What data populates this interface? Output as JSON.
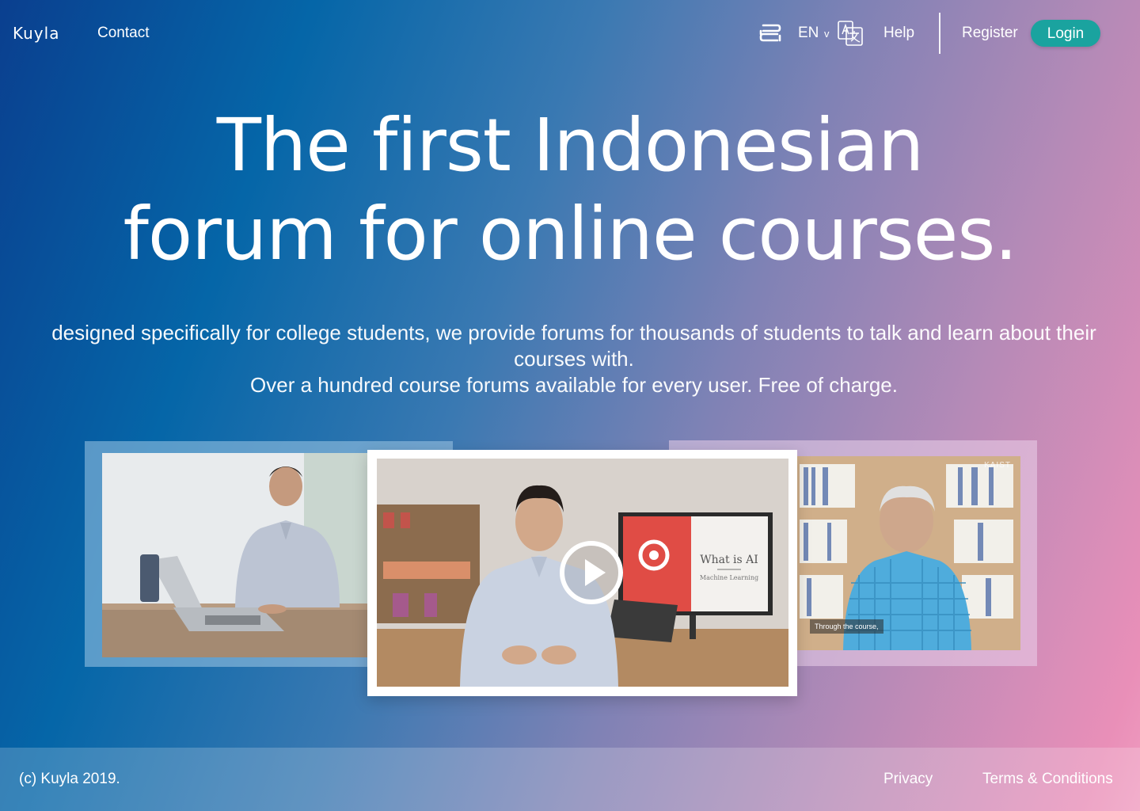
{
  "nav": {
    "logo": "Kuyla",
    "contact_label": "Contact",
    "language": "EN",
    "language_chevron": "v",
    "help_label": "Help",
    "register_label": "Register",
    "login_label": "Login",
    "icons": [
      "stack-icon",
      "translate-icon"
    ]
  },
  "hero": {
    "title_line1": "The first Indonesian",
    "title_line2": "forum for online courses.",
    "desc_line1": "designed specifically for college students, we provide forums for thousands of students to talk and learn about their courses with.",
    "desc_line2": "Over a hundred course forums available for every user. Free of charge."
  },
  "videos": {
    "center_slide_title": "What is AI",
    "center_slide_subtitle": "Machine Learning",
    "right_caption": "Through the course,",
    "right_watermark": "KAIST",
    "play_icon": "play-icon"
  },
  "footer": {
    "copyright": "(c) Kuyla 2019.",
    "privacy_label": "Privacy",
    "terms_label": "Terms & Conditions"
  },
  "colors": {
    "login_button": "#1aa39f",
    "gradient_start": "#0a3f8f",
    "gradient_end": "#f09bbf"
  }
}
